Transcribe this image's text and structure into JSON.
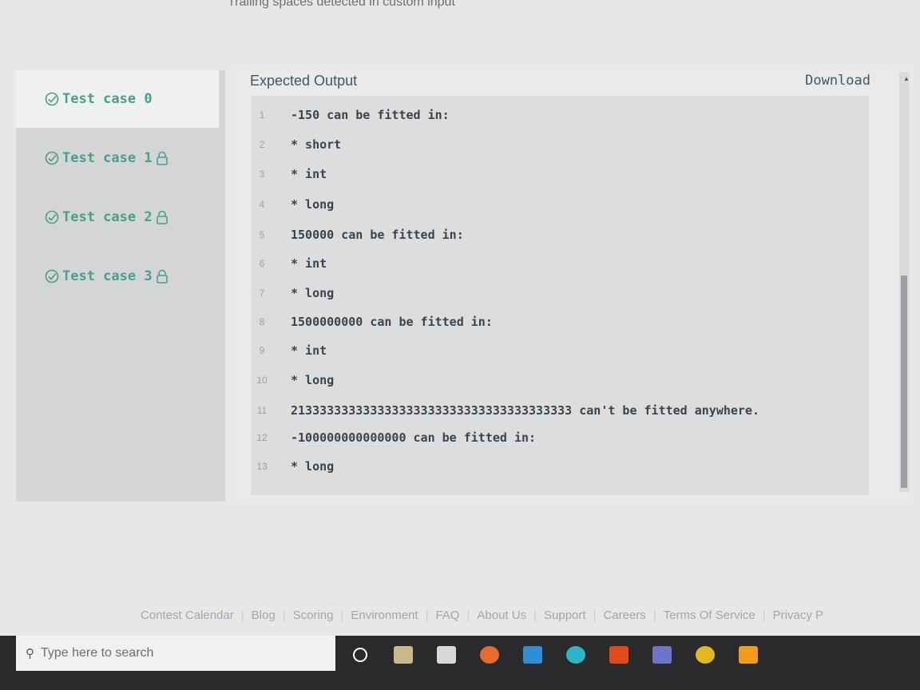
{
  "top_banner": "Trailing spaces detected in custom input",
  "tabs": [
    {
      "label": "Test case 0",
      "locked": false,
      "active": true
    },
    {
      "label": "Test case 1",
      "locked": true,
      "active": false
    },
    {
      "label": "Test case 2",
      "locked": true,
      "active": false
    },
    {
      "label": "Test case 3",
      "locked": true,
      "active": false
    }
  ],
  "panel": {
    "title": "Expected Output",
    "download_label": "Download"
  },
  "lines": [
    {
      "num": "1",
      "text": "-150 can be fitted in:"
    },
    {
      "num": "2",
      "text": "* short"
    },
    {
      "num": "3",
      "text": "* int"
    },
    {
      "num": "4",
      "text": "* long"
    },
    {
      "num": "5",
      "text": "150000 can be fitted in:"
    },
    {
      "num": "6",
      "text": "* int"
    },
    {
      "num": "7",
      "text": "* long"
    },
    {
      "num": "8",
      "text": "1500000000 can be fitted in:"
    },
    {
      "num": "9",
      "text": "* int"
    },
    {
      "num": "10",
      "text": "* long"
    },
    {
      "num": "11",
      "text": "213333333333333333333333333333333333333 can't be fitted anywhere."
    },
    {
      "num": "12",
      "text": "-100000000000000 can be fitted in:"
    },
    {
      "num": "13",
      "text": "* long"
    }
  ],
  "footer_links": [
    "Contest Calendar",
    "Blog",
    "Scoring",
    "Environment",
    "FAQ",
    "About Us",
    "Support",
    "Careers",
    "Terms Of Service",
    "Privacy P"
  ],
  "taskbar": {
    "search_placeholder": "Type here to search",
    "icons": [
      "cortana-icon",
      "task-view-icon",
      "store-icon",
      "firefox-icon",
      "mail-icon",
      "edge-icon",
      "office-icon",
      "teams-icon",
      "chrome-icon",
      "sublime-icon"
    ]
  },
  "colors": {
    "accent": "#48a08b",
    "taskbar": "#2a2a2c"
  }
}
